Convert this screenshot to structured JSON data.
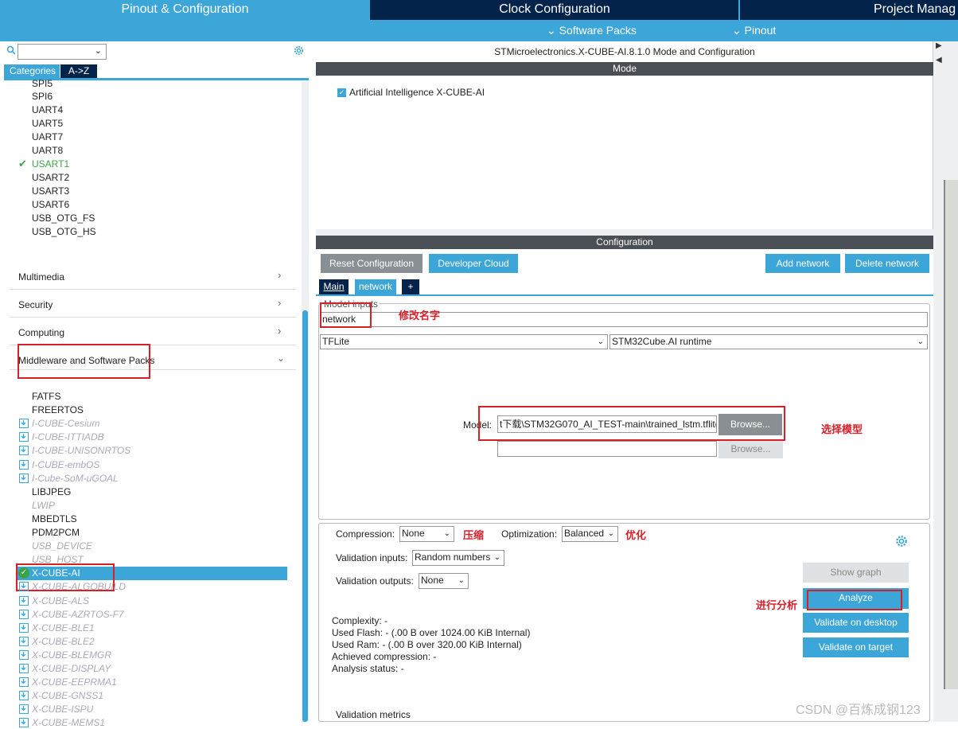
{
  "top_tabs": {
    "pinout": "Pinout & Configuration",
    "clock": "Clock Configuration",
    "project": "Project Manag"
  },
  "sub_menu": {
    "software_packs": "⌄ Software Packs",
    "pinout": "⌄ Pinout"
  },
  "left": {
    "tab_categories": "Categories",
    "tab_az": "A->Z",
    "connectivity_items": [
      "SPI5",
      "SPI6",
      "UART4",
      "UART5",
      "UART7",
      "UART8",
      "USART1",
      "USART2",
      "USART3",
      "USART6",
      "USB_OTG_FS",
      "USB_OTG_HS"
    ],
    "categories": {
      "multimedia": "Multimedia",
      "security": "Security",
      "computing": "Computing",
      "middleware": "Middleware and Software Packs"
    },
    "middleware_items": [
      {
        "label": "FATFS",
        "style": "normal"
      },
      {
        "label": "FREERTOS",
        "style": "normal"
      },
      {
        "label": "I-CUBE-Cesium",
        "style": "pack"
      },
      {
        "label": "I-CUBE-ITTIADB",
        "style": "pack"
      },
      {
        "label": "I-CUBE-UNISONRTOS",
        "style": "pack"
      },
      {
        "label": "I-CUBE-embOS",
        "style": "pack"
      },
      {
        "label": "I-Cube-SoM-uGOAL",
        "style": "pack"
      },
      {
        "label": "LIBJPEG",
        "style": "normal"
      },
      {
        "label": "LWIP",
        "style": "disabled"
      },
      {
        "label": "MBEDTLS",
        "style": "normal"
      },
      {
        "label": "PDM2PCM",
        "style": "normal"
      },
      {
        "label": "USB_DEVICE",
        "style": "disabled"
      },
      {
        "label": "USB_HOST",
        "style": "disabled"
      },
      {
        "label": "X-CUBE-AI",
        "style": "selected"
      },
      {
        "label": "X-CUBE-ALGOBUILD",
        "style": "pack"
      },
      {
        "label": "X-CUBE-ALS",
        "style": "pack"
      },
      {
        "label": "X-CUBE-AZRTOS-F7",
        "style": "pack"
      },
      {
        "label": "X-CUBE-BLE1",
        "style": "pack"
      },
      {
        "label": "X-CUBE-BLE2",
        "style": "pack"
      },
      {
        "label": "X-CUBE-BLEMGR",
        "style": "pack"
      },
      {
        "label": "X-CUBE-DISPLAY",
        "style": "pack"
      },
      {
        "label": "X-CUBE-EEPRMA1",
        "style": "pack"
      },
      {
        "label": "X-CUBE-GNSS1",
        "style": "pack"
      },
      {
        "label": "X-CUBE-ISPU",
        "style": "pack"
      },
      {
        "label": "X-CUBE-MEMS1",
        "style": "pack"
      }
    ]
  },
  "right": {
    "title": "STMicroelectronics.X-CUBE-AI.8.1.0 Mode and Configuration",
    "mode_header": "Mode",
    "mode_checkbox": "Artificial Intelligence X-CUBE-AI",
    "config_header": "Configuration",
    "buttons": {
      "reset": "Reset Configuration",
      "dev_cloud": "Developer Cloud",
      "add_network": "Add network",
      "delete_network": "Delete network"
    },
    "subtabs": {
      "main": "Main",
      "network": "network",
      "plus": "+"
    },
    "model_inputs_legend": "Model inputs",
    "network_name": "network",
    "framework": "TFLite",
    "runtime": "STM32Cube.AI runtime",
    "model_label": "Model:",
    "model_path": "t下载\\STM32G070_AI_TEST-main\\trained_lstm.tflite",
    "browse": "Browse...",
    "browse2": "Browse...",
    "compression_label": "Compression:",
    "compression_value": "None",
    "optimization_label": "Optimization:",
    "optimization_value": "Balanced",
    "val_inputs_label": "Validation inputs:",
    "val_inputs_value": "Random numbers",
    "val_outputs_label": "Validation outputs:",
    "val_outputs_value": "None",
    "show_graph": "Show graph",
    "analyze": "Analyze",
    "validate_desktop": "Validate on desktop",
    "validate_target": "Validate on target",
    "stats": [
      "Complexity: -",
      "Used Flash: - (.00 B over 1024.00 KiB Internal)",
      "Used Ram: - (.00 B over 320.00 KiB Internal)",
      "Achieved compression: -",
      "Analysis status: -"
    ],
    "validation_metrics": "Validation metrics"
  },
  "annotations": {
    "rename": "修改名字",
    "select_model": "选择模型",
    "compress": "压缩",
    "optimize": "优化",
    "analyze": "进行分析"
  },
  "watermark": "CSDN @百炼成钢123"
}
